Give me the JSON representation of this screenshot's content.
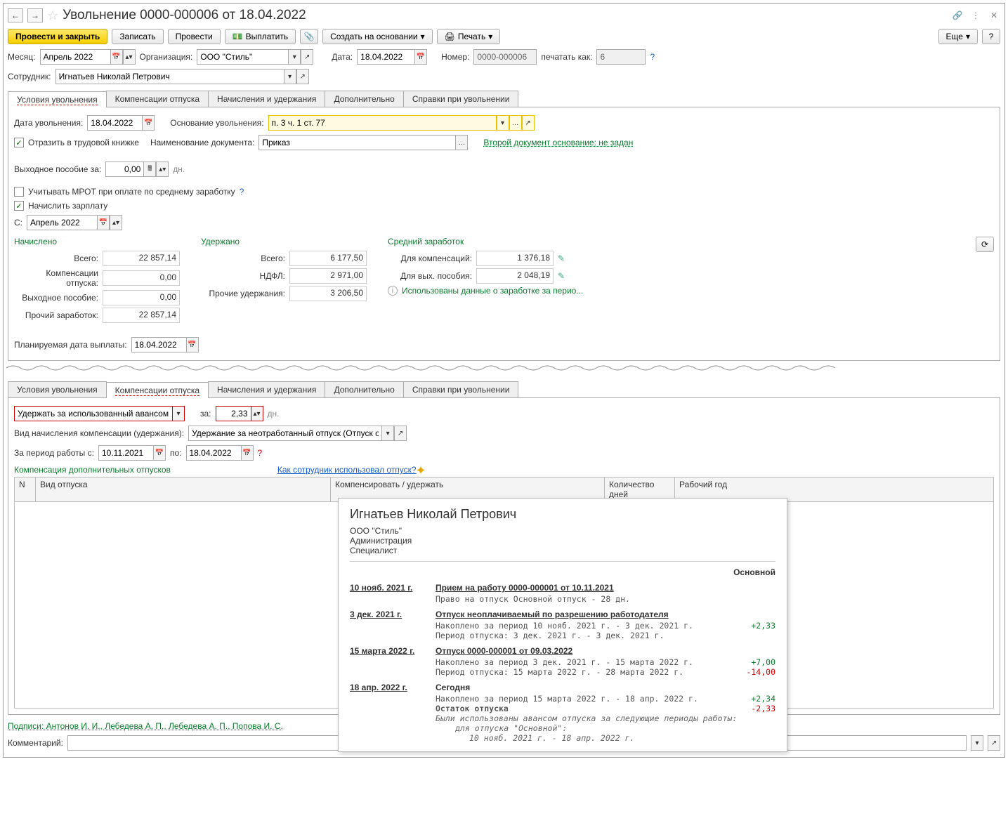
{
  "title": "Увольнение 0000-000006 от 18.04.2022",
  "toolbar": {
    "post_close": "Провести и закрыть",
    "save": "Записать",
    "post": "Провести",
    "pay": "Выплатить",
    "create_based": "Создать на основании",
    "print": "Печать",
    "more": "Еще",
    "help": "?"
  },
  "hdr": {
    "month_lbl": "Месяц:",
    "month": "Апрель 2022",
    "org_lbl": "Организация:",
    "org": "ООО \"Стиль\"",
    "date_lbl": "Дата:",
    "date": "18.04.2022",
    "num_lbl": "Номер:",
    "num": "0000-000006",
    "print_as_lbl": "печатать как:",
    "print_as": "6",
    "emp_lbl": "Сотрудник:",
    "emp": "Игнатьев Николай Петрович"
  },
  "tabs1": [
    "Условия увольнения",
    "Компенсации отпуска",
    "Начисления и удержания",
    "Дополнительно",
    "Справки при увольнении"
  ],
  "p1": {
    "dismiss_date_lbl": "Дата увольнения:",
    "dismiss_date": "18.04.2022",
    "basis_lbl": "Основание увольнения:",
    "basis": "п. 3 ч. 1 ст. 77",
    "reflect_lbl": "Отразить в трудовой книжке",
    "docname_lbl": "Наименование документа:",
    "docname": "Приказ",
    "second_doc": "Второй документ основание: не задан",
    "sev_lbl": "Выходное пособие за:",
    "sev_val": "0,00",
    "sev_unit": "дн.",
    "mrot_lbl": "Учитывать МРОТ при оплате по среднему заработку",
    "calc_salary_lbl": "Начислить зарплату",
    "from_lbl": "С:",
    "from_val": "Апрель 2022"
  },
  "sum": {
    "accrued_h": "Начислено",
    "withheld_h": "Удержано",
    "avg_h": "Средний заработок",
    "total_lbl": "Всего:",
    "total_acc": "22 857,14",
    "total_wh": "6 177,50",
    "comp_lbl": "Компенсации отпуска:",
    "comp_v": "0,00",
    "ndfl_lbl": "НДФЛ:",
    "ndfl_v": "2 971,00",
    "sev2_lbl": "Выходное пособие:",
    "sev2_v": "0,00",
    "other_wh_lbl": "Прочие удержания:",
    "other_wh_v": "3 206,50",
    "other_acc_lbl": "Прочий заработок:",
    "other_acc_v": "22 857,14",
    "for_comp_lbl": "Для компенсаций:",
    "for_comp_v": "1 376,18",
    "for_sev_lbl": "Для вых. пособия:",
    "for_sev_v": "2 048,19",
    "info_txt": "Использованы данные о заработке за перио...",
    "plan_pay_lbl": "Планируемая дата выплаты:",
    "plan_pay": "18.04.2022"
  },
  "tabs2": [
    "Условия увольнения",
    "Компенсации отпуска",
    "Начисления и удержания",
    "Дополнительно",
    "Справки при увольнении"
  ],
  "p2": {
    "action": "Удержать за использованный авансом отпуск",
    "za_lbl": "за:",
    "days": "2,33",
    "days_unit": "дн.",
    "kind_lbl": "Вид начисления компенсации (удержания):",
    "kind": "Удержание за неотработанный отпуск (Отпуск основной)",
    "period_from_lbl": "За период работы с:",
    "period_from": "10.11.2021",
    "period_to_lbl": "по:",
    "period_to": "18.04.2022",
    "extra_comp_lbl": "Компенсация дополнительных отпусков",
    "how_used": "Как сотрудник использовал отпуск?",
    "col_n": "N",
    "col_kind": "Вид отпуска",
    "col_comp": "Компенсировать / удержать",
    "col_days": "Количество дней",
    "col_year": "Рабочий год"
  },
  "popup": {
    "name": "Игнатьев Николай Петрович",
    "org": "ООО \"Стиль\"",
    "dep": "Администрация",
    "pos": "Специалист",
    "main_h": "Основной",
    "events": [
      {
        "d": "10 нояб. 2021 г.",
        "t": "Прием на работу 0000-000001 от 10.11.2021",
        "subs": [
          {
            "txt": "Право на отпуск Основной отпуск - 28 дн."
          }
        ]
      },
      {
        "d": "3 дек. 2021 г.",
        "t": "Отпуск неоплачиваемый по разрешению работодателя",
        "subs": [
          {
            "txt": "Накоплено за период 10 нояб. 2021 г. - 3 дек. 2021 г.",
            "num": "+2,33",
            "cls": "pos"
          },
          {
            "txt": "Период отпуска: 3 дек. 2021 г. - 3 дек. 2021 г."
          }
        ]
      },
      {
        "d": "15 марта 2022 г.",
        "t": "Отпуск 0000-000001 от 09.03.2022",
        "subs": [
          {
            "txt": "Накоплено за период 3 дек. 2021 г. - 15 марта 2022 г.",
            "num": "+7,00",
            "cls": "pos"
          },
          {
            "txt": "Период отпуска: 15 марта 2022 г. - 28 марта 2022 г.",
            "num": "-14,00",
            "cls": "neg"
          }
        ]
      },
      {
        "d": "18 апр. 2022 г.",
        "t": "Сегодня",
        "nolink": true,
        "subs": [
          {
            "txt": "Накоплено за период 15 марта 2022 г. - 18 апр. 2022 г.",
            "num": "+2,34",
            "cls": "pos"
          },
          {
            "txt": "Остаток отпуска",
            "bold": true,
            "num": "-2,33",
            "cls": "neg"
          }
        ]
      }
    ],
    "italic1": "Были использованы авансом отпуска за следующие периоды работы:",
    "italic2": "для отпуска \"Основной\":",
    "italic3": "10 нояб. 2021 г. - 18 апр. 2022 г."
  },
  "footer": {
    "sign": "Подписи: Антонов И. И., Лебедева А. П., Лебедева А. П., Попова И. С.",
    "comment_lbl": "Комментарий:"
  }
}
